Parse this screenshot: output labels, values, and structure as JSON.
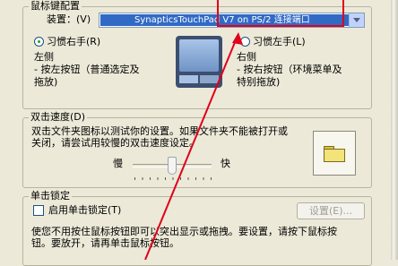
{
  "mouse_group": {
    "title": "鼠标键配置",
    "device_label": "装置：(V)",
    "device_value": "SynapticsTouchPad V7 on PS/2 连接端口",
    "right_hand": {
      "label": "习惯右手(R)",
      "selected": true,
      "side": "左侧",
      "desc_line1": " - 按左按钮（普通选定及",
      "desc_line2": "拖放)"
    },
    "left_hand": {
      "label": "习惯左手(L)",
      "selected": false,
      "side": "右侧",
      "desc_line1": " - 按右按钮（环境菜单及",
      "desc_line2": "特别拖放)"
    }
  },
  "double_click_group": {
    "title": "双击速度(D)",
    "desc_line1": "双击文件夹图标以测试你的设置。如果文件夹不能被打开或",
    "desc_line2": "关闭，请尝试用较慢的双击速度设定。",
    "slow_label": "慢",
    "fast_label": "快",
    "speed_fraction": 0.5
  },
  "click_lock_group": {
    "title": "单击锁定",
    "checkbox_label": "启用单击锁定(T)",
    "checked": false,
    "settings_button": "设置(E)...",
    "desc_line1": "使您不用按住鼠标按钮即可以突出显示或拖拽。要设置，请按下鼠标按",
    "desc_line2": "钮。要放开，请再单击鼠标按钮。"
  },
  "colors": {
    "annotation": "#e0001a",
    "selection": "#316ac5"
  }
}
